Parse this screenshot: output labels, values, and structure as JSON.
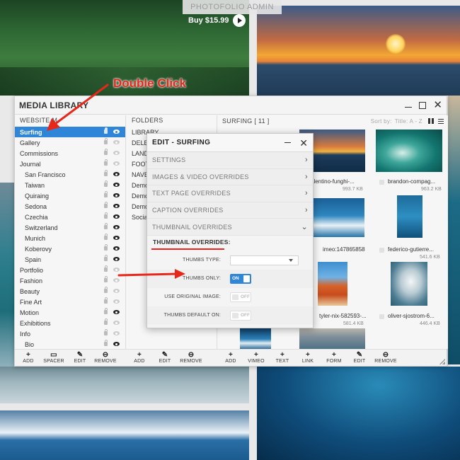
{
  "header": {
    "admin_label": "PHOTOFOLIO ADMIN",
    "buy_label": "Buy $15.99"
  },
  "annotation": {
    "double_click": "Double Click"
  },
  "media_library": {
    "title": "MEDIA LIBRARY",
    "website_menu_header": "WEBSITE M",
    "website_items": [
      {
        "label": "Surfing",
        "indent": false,
        "selected": true
      },
      {
        "label": "Gallery",
        "indent": false
      },
      {
        "label": "Commissions",
        "indent": false
      },
      {
        "label": "Journal",
        "indent": false
      },
      {
        "label": "San Francisco",
        "indent": true
      },
      {
        "label": "Taiwan",
        "indent": true
      },
      {
        "label": "Quiraing",
        "indent": true
      },
      {
        "label": "Sedona",
        "indent": true
      },
      {
        "label": "Czechia",
        "indent": true
      },
      {
        "label": "Switzerland",
        "indent": true
      },
      {
        "label": "Munich",
        "indent": true
      },
      {
        "label": "Koberovy",
        "indent": true
      },
      {
        "label": "Spain",
        "indent": true
      },
      {
        "label": "Portfolio",
        "indent": false
      },
      {
        "label": "Fashion",
        "indent": false
      },
      {
        "label": "Beauty",
        "indent": false
      },
      {
        "label": "Fine Art",
        "indent": false
      },
      {
        "label": "Motion",
        "indent": false
      },
      {
        "label": "Exhibitions",
        "indent": false
      },
      {
        "label": "Info",
        "indent": false
      },
      {
        "label": "Bio",
        "indent": true
      }
    ],
    "folders_header": "FOLDERS",
    "folder_items": [
      "LIBRARY",
      "DELE",
      "LAND",
      "FOOT",
      "NAVB",
      "Demo",
      "Demo",
      "Demo",
      "Social"
    ],
    "surfing_header": "SURFING [ 11 ]",
    "sort_label": "Sort by:",
    "sort_value": "Title: A - Z",
    "thumbnails": [
      {
        "name": "valentino-funghi-...",
        "size": "993.7 KB"
      },
      {
        "name": "brandon-compag...",
        "size": "963.2 KB"
      },
      {
        "name": "imeo:147865858",
        "size": ""
      },
      {
        "name": "federico-gutierre...",
        "size": "541.6 KB"
      },
      {
        "name": "tyler-nix-582593-...",
        "size": "581.4 KB"
      },
      {
        "name": "oliver-sjostrom-6...",
        "size": "446.4 KB"
      }
    ],
    "footer_left": [
      {
        "glyph": "+",
        "label": "ADD"
      },
      {
        "glyph": "▭",
        "label": "SPACER"
      },
      {
        "glyph": "✎",
        "label": "EDIT"
      },
      {
        "glyph": "⊖",
        "label": "REMOVE"
      }
    ],
    "footer_mid": [
      {
        "glyph": "+",
        "label": "ADD"
      },
      {
        "glyph": "✎",
        "label": "EDIT"
      },
      {
        "glyph": "⊖",
        "label": "REMOVE"
      }
    ],
    "footer_right": [
      {
        "glyph": "+",
        "label": "ADD"
      },
      {
        "glyph": "+",
        "label": "VIMEO"
      },
      {
        "glyph": "+",
        "label": "TEXT"
      },
      {
        "glyph": "+",
        "label": "LINK"
      },
      {
        "glyph": "+",
        "label": "FORM"
      },
      {
        "glyph": "✎",
        "label": "EDIT"
      },
      {
        "glyph": "⊖",
        "label": "REMOVE"
      }
    ]
  },
  "edit_panel": {
    "title": "EDIT - SURFING",
    "sections": [
      {
        "label": "SETTINGS",
        "chevron": "›"
      },
      {
        "label": "IMAGES & VIDEO OVERRIDES",
        "chevron": "›"
      },
      {
        "label": "TEXT PAGE OVERRIDES",
        "chevron": "›"
      },
      {
        "label": "CAPTION OVERRIDES",
        "chevron": "›"
      },
      {
        "label": "THUMBNAIL OVERRIDES",
        "chevron": "⌄"
      }
    ],
    "subhead": "THUMBNAIL OVERRIDES:",
    "fields": {
      "thumbs_type_label": "THUMBS TYPE:",
      "thumbs_type_value": "",
      "thumbs_only_label": "THUMBS ONLY:",
      "thumbs_only_value": "ON",
      "use_original_label": "USE ORIGINAL IMAGE:",
      "use_original_value": "OFF",
      "thumbs_default_label": "THUMBS DEFAULT ON:",
      "thumbs_default_value": "OFF"
    }
  },
  "colors": {
    "accent": "#2f86d8",
    "annotation_red": "#e8271b"
  }
}
